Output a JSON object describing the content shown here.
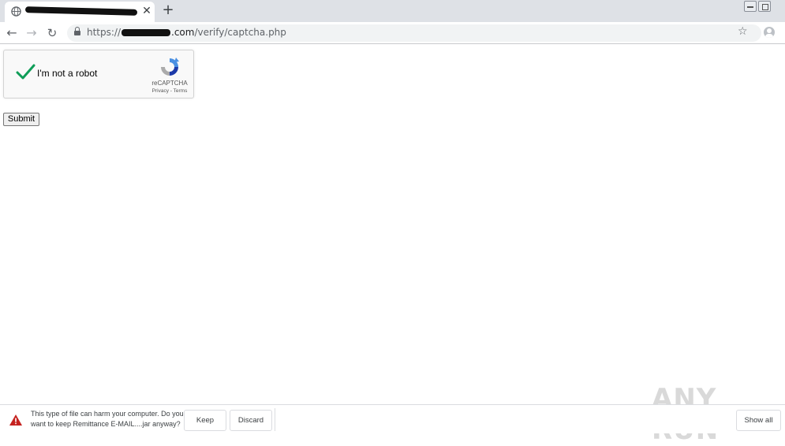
{
  "browser": {
    "tab": {
      "title": "",
      "close_glyph": "✕"
    },
    "new_tab_glyph": "+",
    "toolbar": {
      "back_glyph": "←",
      "forward_glyph": "→",
      "reload_glyph": "↻",
      "url_scheme": "https://",
      "url_host_suffix": ".com",
      "url_path": "/verify/captcha.php",
      "star_glyph": "☆"
    }
  },
  "recaptcha": {
    "label": "I'm not a robot",
    "brand": "reCAPTCHA",
    "links": "Privacy - Terms",
    "checked": true,
    "check_color": "#0f9d58"
  },
  "form": {
    "submit_label": "Submit"
  },
  "download_bar": {
    "message": "This type of file can harm your computer. Do you want to keep Remittance E-MAIL....jar anyway?",
    "keep_label": "Keep",
    "discard_label": "Discard",
    "show_all_label": "Show all",
    "warning_color": "#c5221f"
  },
  "watermark": {
    "text": "ANY RUN"
  }
}
